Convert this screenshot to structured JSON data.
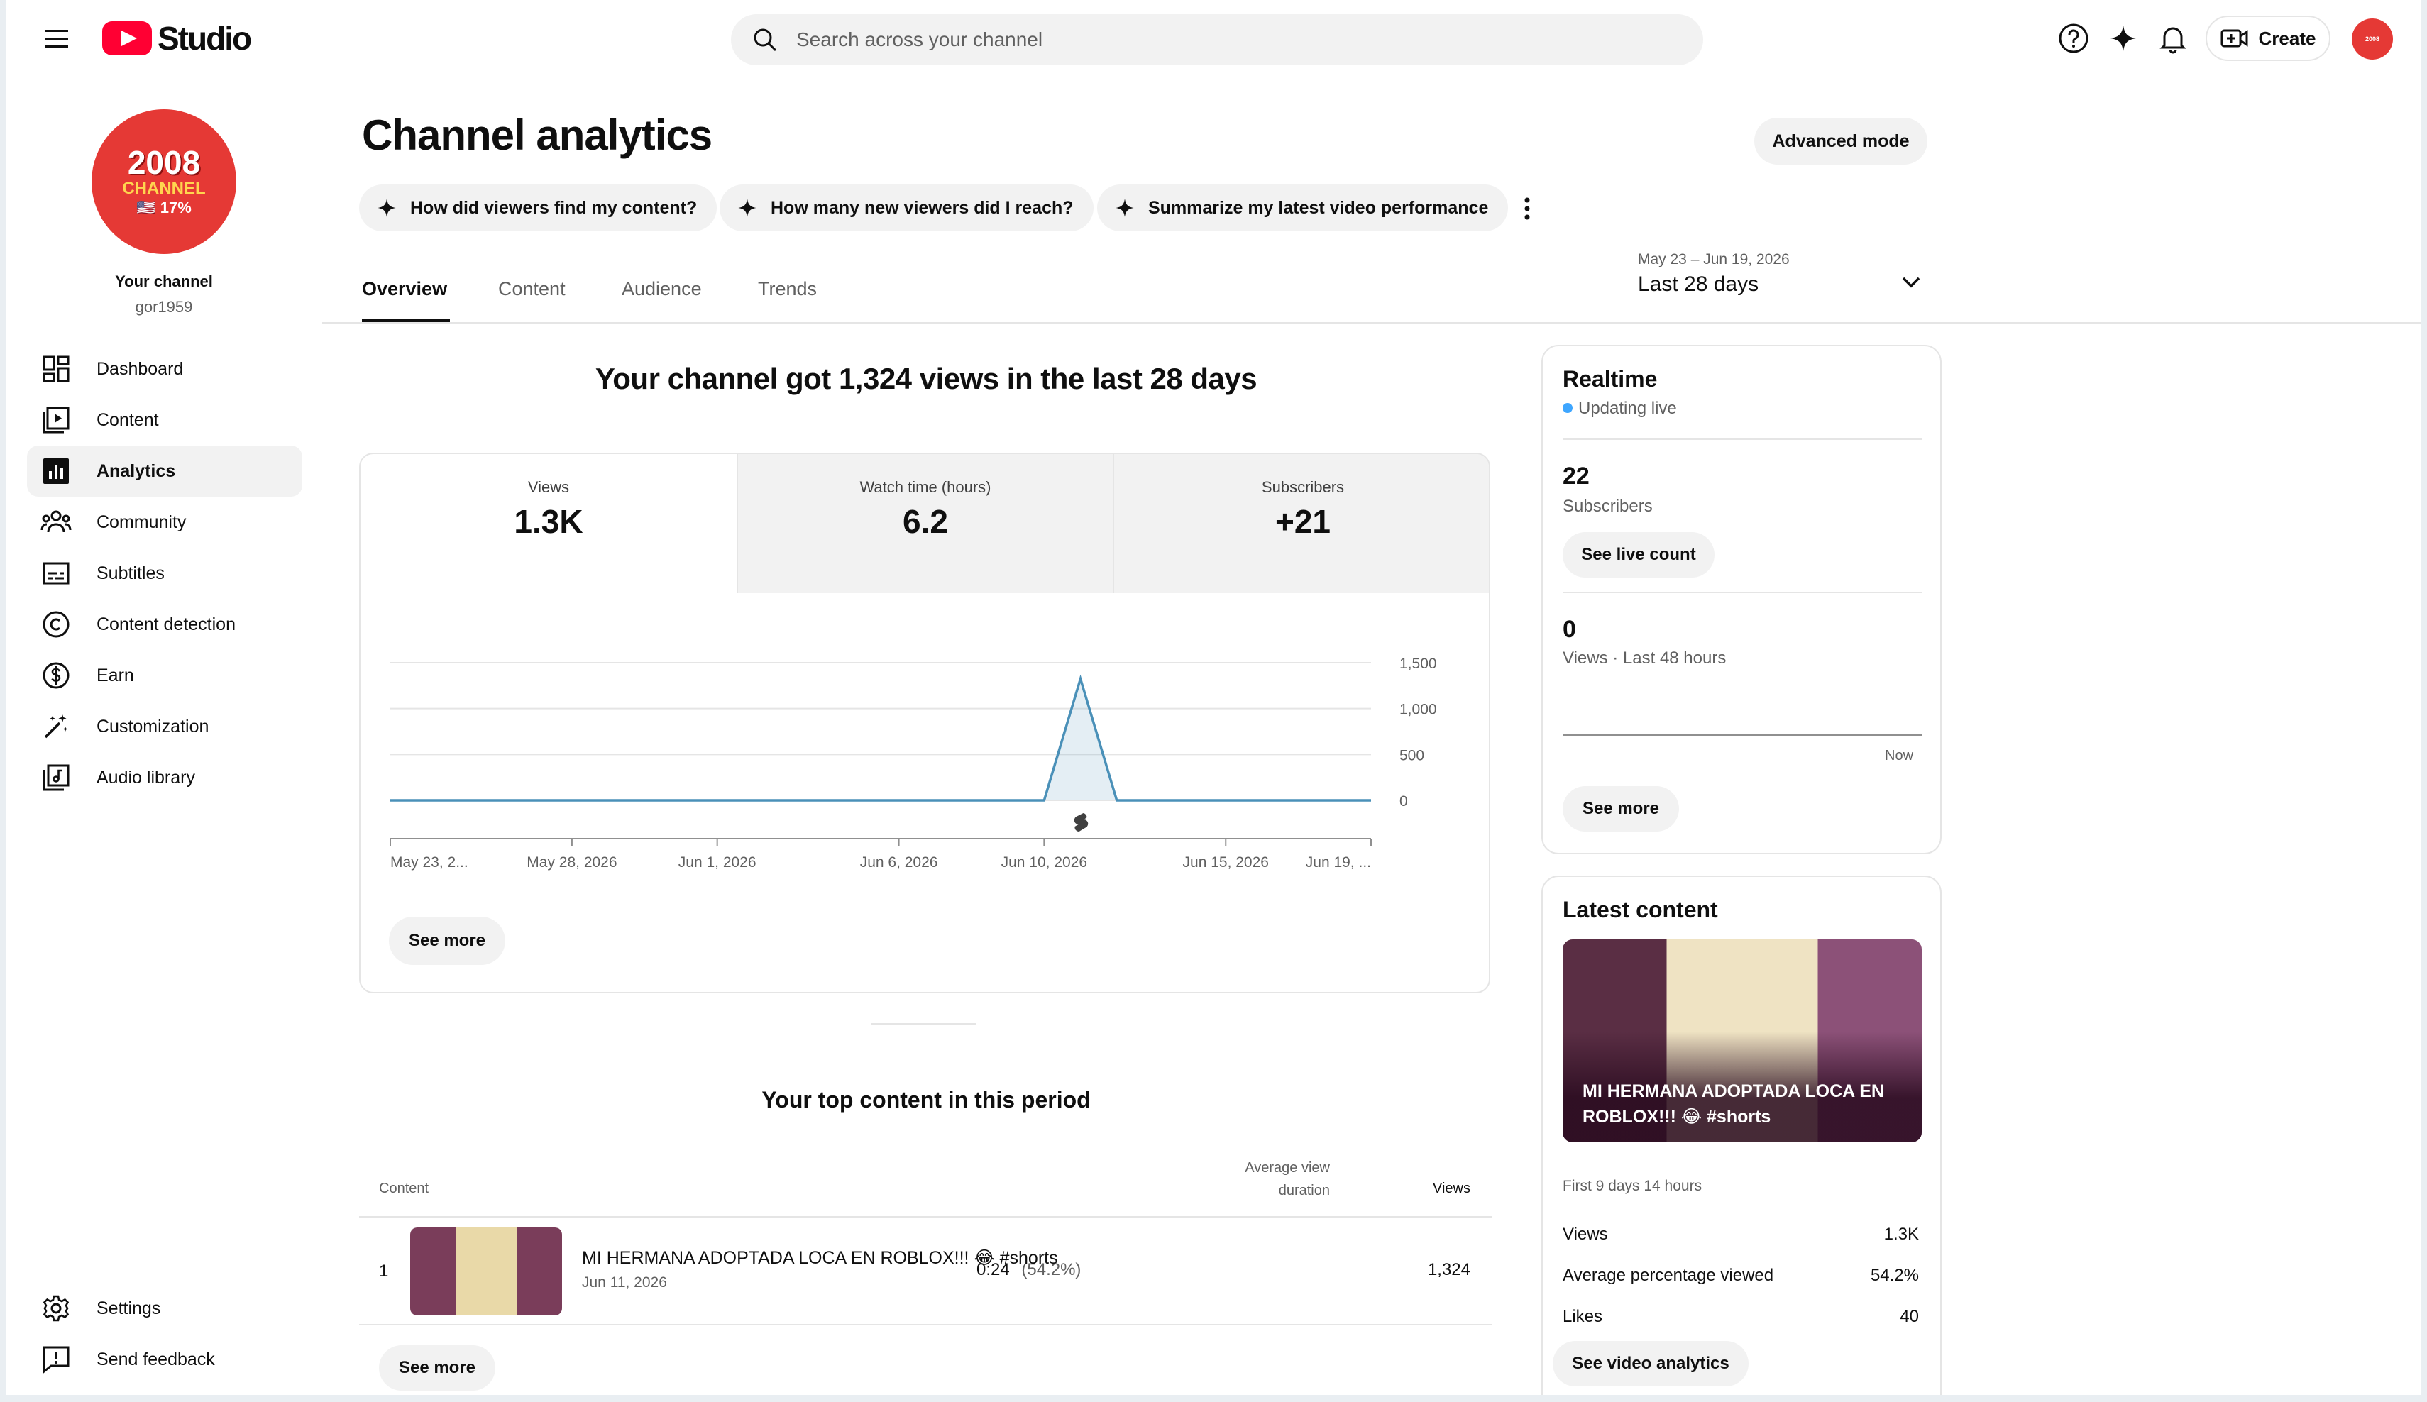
{
  "header": {
    "brand": "Studio",
    "search_placeholder": "Search across your channel",
    "create_label": "Create"
  },
  "channel": {
    "avatar_line1": "2008",
    "avatar_line2": "CHANNEL",
    "avatar_line3": "🇺🇸 17%",
    "title": "Your channel",
    "handle": "gor1959"
  },
  "sidebar": {
    "items": [
      {
        "label": "Dashboard",
        "icon": "dashboard-icon"
      },
      {
        "label": "Content",
        "icon": "content-icon"
      },
      {
        "label": "Analytics",
        "icon": "analytics-icon",
        "active": true
      },
      {
        "label": "Community",
        "icon": "community-icon"
      },
      {
        "label": "Subtitles",
        "icon": "subtitles-icon"
      },
      {
        "label": "Content detection",
        "icon": "copyright-icon"
      },
      {
        "label": "Earn",
        "icon": "dollar-icon"
      },
      {
        "label": "Customization",
        "icon": "magic-wand-icon"
      },
      {
        "label": "Audio library",
        "icon": "audio-library-icon"
      }
    ],
    "settings_label": "Settings",
    "feedback_label": "Send feedback"
  },
  "main": {
    "title": "Channel analytics",
    "advanced_mode": "Advanced mode",
    "chips": [
      "How did viewers find my content?",
      "How many new viewers did I reach?",
      "Summarize my latest video performance"
    ],
    "tabs": [
      "Overview",
      "Content",
      "Audience",
      "Trends"
    ],
    "active_tab": "Overview",
    "date_range": "May 23 – Jun 19, 2026",
    "date_label": "Last 28 days",
    "summary": "Your channel got 1,324 views in the last 28 days",
    "metrics": [
      {
        "label": "Views",
        "value": "1.3K"
      },
      {
        "label": "Watch time (hours)",
        "value": "6.2"
      },
      {
        "label": "Subscribers",
        "value": "+21"
      }
    ],
    "see_more": "See more"
  },
  "chart_data": {
    "type": "area",
    "title": "",
    "xlabel": "",
    "ylabel": "",
    "ylim": [
      0,
      1500
    ],
    "y_ticks": [
      "1,500",
      "1,000",
      "500",
      "0"
    ],
    "x_tick_labels": [
      "May 23, 2...",
      "May 28, 2026",
      "Jun 1, 2026",
      "Jun 6, 2026",
      "Jun 10, 2026",
      "Jun 15, 2026",
      "Jun 19, ..."
    ],
    "x": [
      "May 23",
      "May 24",
      "May 25",
      "May 26",
      "May 27",
      "May 28",
      "May 29",
      "May 30",
      "May 31",
      "Jun 1",
      "Jun 2",
      "Jun 3",
      "Jun 4",
      "Jun 5",
      "Jun 6",
      "Jun 7",
      "Jun 8",
      "Jun 9",
      "Jun 10",
      "Jun 11",
      "Jun 12",
      "Jun 13",
      "Jun 14",
      "Jun 15",
      "Jun 16",
      "Jun 17",
      "Jun 18",
      "Jun 19"
    ],
    "series": [
      {
        "values": [
          0,
          0,
          0,
          0,
          0,
          0,
          0,
          0,
          0,
          0,
          0,
          0,
          0,
          0,
          0,
          0,
          0,
          0,
          0,
          1324,
          0,
          0,
          0,
          0,
          0,
          0,
          0,
          0
        ]
      }
    ],
    "grid": true,
    "color": "#4a90b8",
    "marker_icon": "shorts-icon"
  },
  "top_content": {
    "title": "Your top content in this period",
    "col_content": "Content",
    "col_avd_1": "Average view",
    "col_avd_2": "duration",
    "col_views": "Views",
    "rows": [
      {
        "rank": "1",
        "title": "MI HERMANA ADOPTADA LOCA EN ROBLOX!!! 😂 #shorts",
        "date": "Jun 11, 2026",
        "avd": "0:24",
        "avd_pct": "(54.2%)",
        "views": "1,324"
      }
    ],
    "see_more": "See more"
  },
  "realtime": {
    "title": "Realtime",
    "status": "Updating live",
    "subs_value": "22",
    "subs_label": "Subscribers",
    "live_count_btn": "See live count",
    "views_value": "0",
    "views_label": "Views · Last 48 hours",
    "now_label": "Now",
    "see_more": "See more"
  },
  "latest": {
    "title": "Latest content",
    "video_title": "MI HERMANA ADOPTADA LOCA EN ROBLOX!!! 😂 #shorts",
    "period": "First 9 days 14 hours",
    "stats": [
      {
        "label": "Views",
        "value": "1.3K"
      },
      {
        "label": "Average percentage viewed",
        "value": "54.2%"
      },
      {
        "label": "Likes",
        "value": "40"
      }
    ],
    "btn": "See video analytics"
  }
}
